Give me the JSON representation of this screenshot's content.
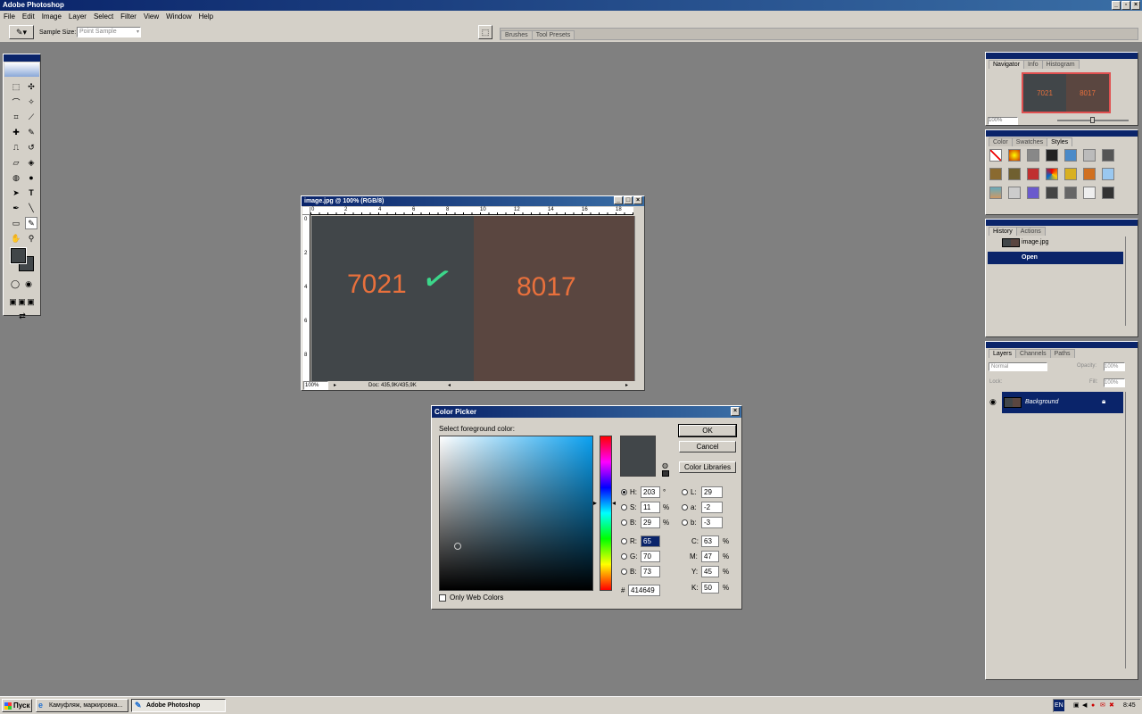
{
  "app": {
    "title": "Adobe Photoshop"
  },
  "menu": [
    "File",
    "Edit",
    "Image",
    "Layer",
    "Select",
    "Filter",
    "View",
    "Window",
    "Help"
  ],
  "options": {
    "sample_size_label": "Sample Size:",
    "sample_size_value": "Point Sample",
    "tab_brushes": "Brushes",
    "tab_tool_presets": "Tool Presets"
  },
  "document": {
    "title": "image.jpg @ 100% (RGB/8)",
    "ruler_h": [
      "0",
      "2",
      "4",
      "6",
      "8",
      "10",
      "12",
      "14",
      "16",
      "18"
    ],
    "ruler_v": [
      "0",
      "2",
      "4",
      "6",
      "8"
    ],
    "left_label": "7021",
    "right_label": "8017",
    "checkmark": "✓",
    "zoom": "100%",
    "doc_info": "Doc: 435,9K/435,9K",
    "left_color": "#414649",
    "right_color": "#5a4640"
  },
  "navigator": {
    "tabs": [
      "Navigator",
      "Info",
      "Histogram"
    ],
    "zoom": "100%",
    "left_label": "7021",
    "right_label": "8017"
  },
  "color_panel": {
    "tabs": [
      "Color",
      "Swatches",
      "Styles"
    ]
  },
  "history": {
    "tabs": [
      "History",
      "Actions"
    ],
    "snapshot": "image.jpg",
    "state": "Open"
  },
  "layers": {
    "tabs": [
      "Layers",
      "Channels",
      "Paths"
    ],
    "blend": "Normal",
    "opacity_label": "Opacity:",
    "opacity": "100%",
    "lock_label": "Lock:",
    "fill_label": "Fill:",
    "fill": "100%",
    "layer_name": "Background"
  },
  "color_picker": {
    "title": "Color Picker",
    "prompt": "Select foreground color:",
    "ok": "OK",
    "cancel": "Cancel",
    "libraries": "Color Libraries",
    "web_only": "Only Web Colors",
    "h_label": "H:",
    "h": "203",
    "h_unit": "°",
    "s_label": "S:",
    "s": "11",
    "s_unit": "%",
    "b_label": "B:",
    "b": "29",
    "b_unit": "%",
    "r_label": "R:",
    "r": "65",
    "g_label": "G:",
    "g": "70",
    "bl_label": "B:",
    "bl": "73",
    "l_label": "L:",
    "l": "29",
    "a_label": "a:",
    "a": "-2",
    "lb_label": "b:",
    "lb": "-3",
    "c_label": "C:",
    "c": "63",
    "c_unit": "%",
    "m_label": "M:",
    "m": "47",
    "m_unit": "%",
    "y_label": "Y:",
    "y": "45",
    "y_unit": "%",
    "k_label": "K:",
    "k": "50",
    "k_unit": "%",
    "hex_label": "#",
    "hex": "414649",
    "swatch_color": "#414649"
  },
  "taskbar": {
    "start": "Пуск",
    "task1": "Камуфляж, маркировка...",
    "task2": "Adobe Photoshop",
    "lang": "EN",
    "clock": "8:45"
  }
}
